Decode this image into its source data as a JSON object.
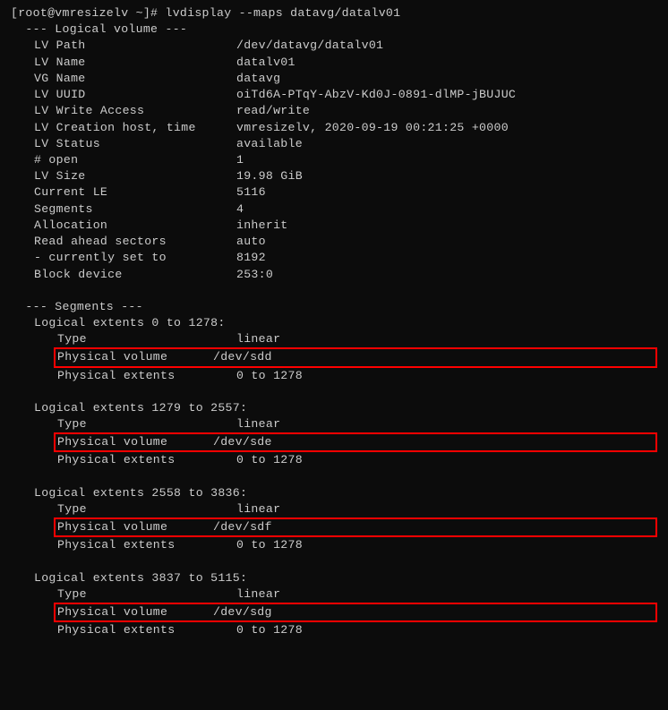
{
  "prompt": "[root@vmresizelv ~]# lvdisplay --maps datavg/datalv01",
  "lv_header": "  --- Logical volume ---",
  "lv": [
    {
      "k": "LV Path",
      "v": "/dev/datavg/datalv01"
    },
    {
      "k": "LV Name",
      "v": "datalv01"
    },
    {
      "k": "VG Name",
      "v": "datavg"
    },
    {
      "k": "LV UUID",
      "v": "oiTd6A-PTqY-AbzV-Kd0J-0891-dlMP-jBUJUC"
    },
    {
      "k": "LV Write Access",
      "v": "read/write"
    },
    {
      "k": "LV Creation host, time",
      "v": "vmresizelv, 2020-09-19 00:21:25 +0000"
    },
    {
      "k": "LV Status",
      "v": "available"
    },
    {
      "k": "# open",
      "v": "1"
    },
    {
      "k": "LV Size",
      "v": "19.98 GiB"
    },
    {
      "k": "Current LE",
      "v": "5116"
    },
    {
      "k": "Segments",
      "v": "4"
    },
    {
      "k": "Allocation",
      "v": "inherit"
    },
    {
      "k": "Read ahead sectors",
      "v": "auto"
    },
    {
      "k": "- currently set to",
      "v": "8192"
    },
    {
      "k": "Block device",
      "v": "253:0"
    }
  ],
  "seg_header": "  --- Segments ---",
  "segments": [
    {
      "range": "Logical extents 0 to 1278:",
      "type_k": "Type",
      "type_v": "linear",
      "pv_k": "Physical volume",
      "pv_v": "/dev/sdd",
      "pe_k": "Physical extents",
      "pe_v": "0 to 1278"
    },
    {
      "range": "Logical extents 1279 to 2557:",
      "type_k": "Type",
      "type_v": "linear",
      "pv_k": "Physical volume",
      "pv_v": "/dev/sde",
      "pe_k": "Physical extents",
      "pe_v": "0 to 1278"
    },
    {
      "range": "Logical extents 2558 to 3836:",
      "type_k": "Type",
      "type_v": "linear",
      "pv_k": "Physical volume",
      "pv_v": "/dev/sdf",
      "pe_k": "Physical extents",
      "pe_v": "0 to 1278"
    },
    {
      "range": "Logical extents 3837 to 5115:",
      "type_k": "Type",
      "type_v": "linear",
      "pv_k": "Physical volume",
      "pv_v": "/dev/sdg",
      "pe_k": "Physical extents",
      "pe_v": "0 to 1278"
    }
  ]
}
